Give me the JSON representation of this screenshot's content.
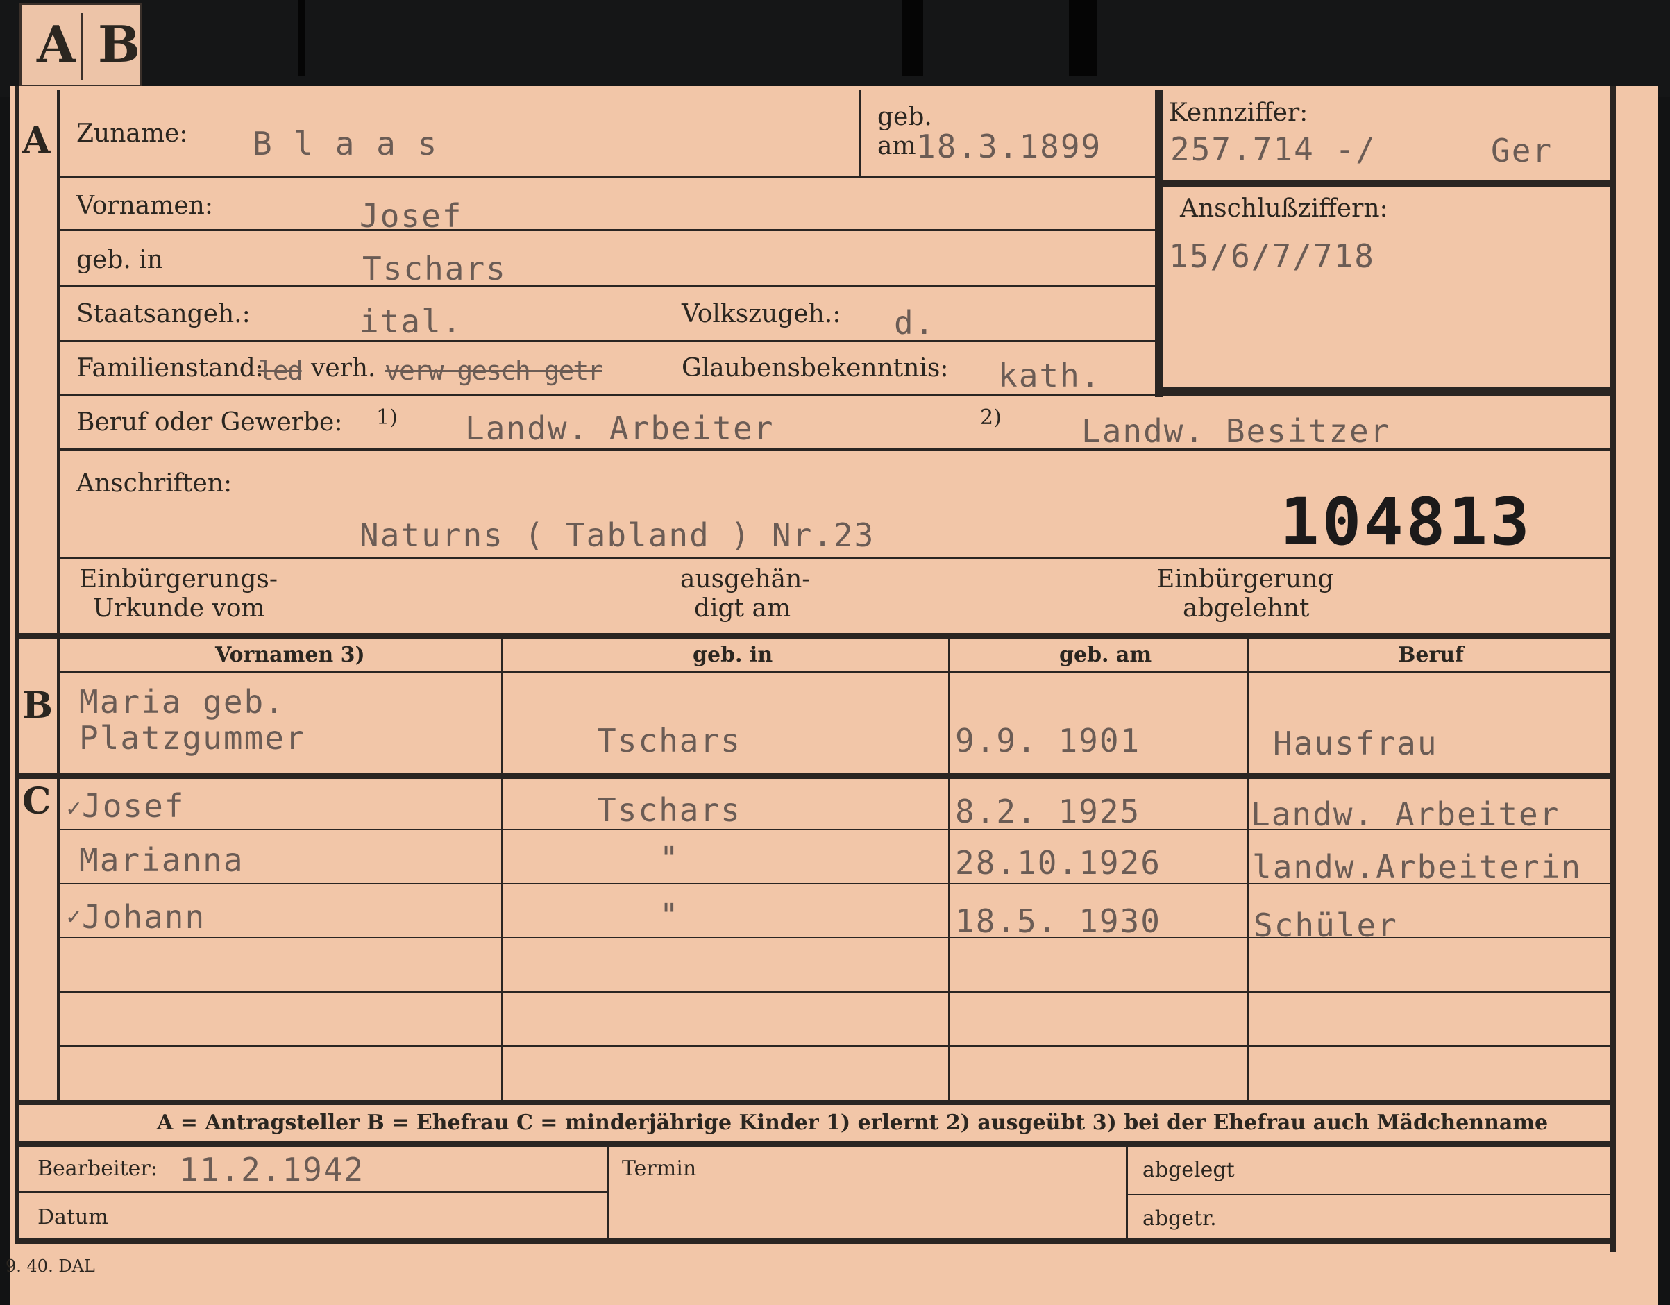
{
  "tab": {
    "a": "A",
    "b": "B"
  },
  "sections": {
    "a": "A",
    "b": "B",
    "c": "C"
  },
  "labels": {
    "zuname": "Zuname:",
    "geb": "geb.",
    "am": "am",
    "kennziffer": "Kennziffer:",
    "anschlussziffern": "Anschlußziffern:",
    "vornamen": "Vornamen:",
    "geb_in": "geb. in",
    "staatsangeh": "Staatsangeh.:",
    "volkszugeh": "Volkszugeh.:",
    "familienstand": "Familienstand:",
    "glaubensbekenntnis": "Glaubensbekenntnis:",
    "beruf": "Beruf oder Gewerbe:",
    "fn1": "1)",
    "fn2": "2)",
    "anschriften": "Anschriften:",
    "einb_urkunde_1": "Einbürgerungs-",
    "einb_urkunde_2": "Urkunde vom",
    "ausgehaendigt_1": "ausgehän-",
    "ausgehaendigt_2": "digt am",
    "einb_abgelehnt_1": "Einbürgerung",
    "einb_abgelehnt_2": "abgelehnt"
  },
  "applicant": {
    "zuname": "B l a a s",
    "geb_am": "18.3.1899",
    "kennziffer": "257.714 -/",
    "kennziffer_suffix": "Ger",
    "anschlussziffern": "15/6/7/718",
    "vornamen": "Josef",
    "geb_in": "Tschars",
    "staatsangeh": "ital.",
    "volkszugeh": "d.",
    "familienstand_struck_1": "led",
    "familienstand_kept": "verh.",
    "familienstand_struck_2": "verw gesch getr",
    "glaubensbekenntnis": "kath.",
    "beruf_1": "Landw. Arbeiter",
    "beruf_2": "Landw. Besitzer",
    "anschrift": "Naturns ( Tabland ) Nr.23",
    "number": "104813"
  },
  "table_headers": [
    "Vornamen 3)",
    "geb. in",
    "geb. am",
    "Beruf"
  ],
  "spouse": {
    "name_1": "Maria geb.",
    "name_2": "Platzgummer",
    "geb_in": "Tschars",
    "geb_am": "9.9. 1901",
    "beruf": "Hausfrau"
  },
  "children": [
    {
      "name": "Josef",
      "geb_in": "Tschars",
      "geb_am": "8.2. 1925",
      "beruf": "Landw. Arbeiter"
    },
    {
      "name": "Marianna",
      "geb_in": "\"",
      "geb_am": "28.10.1926",
      "beruf": "landw.Arbeiterin"
    },
    {
      "name": "Johann",
      "geb_in": "\"",
      "geb_am": "18.5. 1930",
      "beruf": "Schüler"
    }
  ],
  "legend": "A = Antragsteller   B = Ehefrau   C = minderjährige Kinder   1) erlernt   2) ausgeübt   3) bei der Ehefrau auch Mädchenname",
  "footer": {
    "bearbeiter_label": "Bearbeiter:",
    "bearbeiter_value": "11.2.1942",
    "datum_label": "Datum",
    "termin_label": "Termin",
    "abgelegt_label": "abgelegt",
    "abgetr_label": "abgetr."
  },
  "print_mark": "9. 40. DAL"
}
